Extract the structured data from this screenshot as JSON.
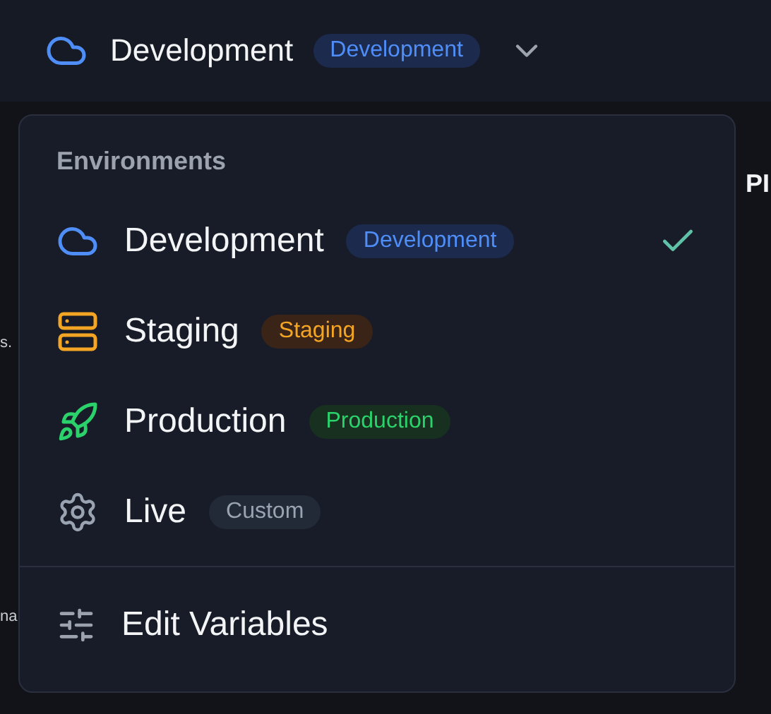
{
  "trigger": {
    "name": "Development",
    "badge": "Development",
    "kind": "cloud",
    "expanded": true
  },
  "background": {
    "right_fragment": "PI",
    "left_fragments": [
      "s.",
      "na"
    ]
  },
  "menu": {
    "heading": "Environments",
    "items": [
      {
        "name": "Development",
        "badge": "Development",
        "kind": "cloud",
        "selected": true
      },
      {
        "name": "Staging",
        "badge": "Staging",
        "kind": "server",
        "selected": false
      },
      {
        "name": "Production",
        "badge": "Production",
        "kind": "rocket",
        "selected": false
      },
      {
        "name": "Live",
        "badge": "Custom",
        "kind": "gear",
        "selected": false
      }
    ],
    "footer": {
      "label": "Edit Variables"
    }
  }
}
